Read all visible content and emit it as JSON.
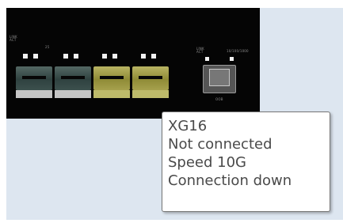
{
  "panel": {
    "group_link_act": "LINK\nACT",
    "group_label": "25",
    "oob_link_act": "LINK\nACT",
    "oob_speed_label": "10/100/1000",
    "oob_label": "OOB",
    "sfp_ports": [
      {
        "name": "port-1",
        "color": "#3a4d4a"
      },
      {
        "name": "port-2",
        "color": "#3a4d4a"
      },
      {
        "name": "port-3",
        "color": "#9a9640"
      },
      {
        "name": "port-4",
        "color": "#9a9640"
      }
    ]
  },
  "tooltip": {
    "port": "XG16",
    "status": "Not connected",
    "speed": "Speed 10G",
    "connection": "Connection down"
  },
  "colors": {
    "panel_bg": "#050505",
    "backdrop": "#dde6f0",
    "text": "#4a4a4a"
  }
}
